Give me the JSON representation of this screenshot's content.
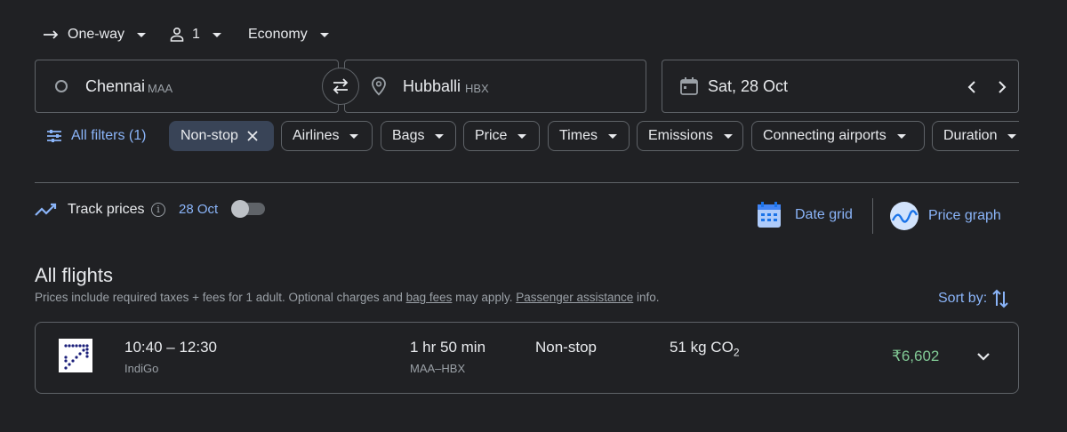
{
  "trip_options": {
    "trip_type": "One-way",
    "passengers": "1",
    "cabin_class": "Economy"
  },
  "search": {
    "origin_city": "Chennai",
    "origin_code": "MAA",
    "destination_city": "Hubballi",
    "destination_code": "HBX",
    "date": "Sat, 28 Oct"
  },
  "filters": {
    "all_filters": "All filters (1)",
    "chips": [
      "Non-stop",
      "Airlines",
      "Bags",
      "Price",
      "Times",
      "Emissions",
      "Connecting airports",
      "Duration"
    ]
  },
  "tracking": {
    "label": "Track prices",
    "date": "28 Oct",
    "enabled": false
  },
  "views": {
    "date_grid": "Date grid",
    "price_graph": "Price graph"
  },
  "results": {
    "heading": "All flights",
    "note_prefix": "Prices include required taxes + fees for 1 adult. Optional charges and ",
    "note_link1": "bag fees",
    "note_middle": " may apply. ",
    "note_link2": "Passenger assistance",
    "note_suffix": " info.",
    "sort_label": "Sort by:"
  },
  "flights": [
    {
      "times": "10:40 – 12:30",
      "airline": "IndiGo",
      "duration": "1 hr 50 min",
      "route": "MAA–HBX",
      "stops": "Non-stop",
      "emissions_value": "51 kg CO",
      "emissions_sub": "2",
      "price": "₹6,602"
    }
  ],
  "colors": {
    "background": "#202124",
    "accent": "#8ab4f8",
    "price": "#81c995",
    "border": "#5f6368",
    "active_chip": "#394457"
  }
}
